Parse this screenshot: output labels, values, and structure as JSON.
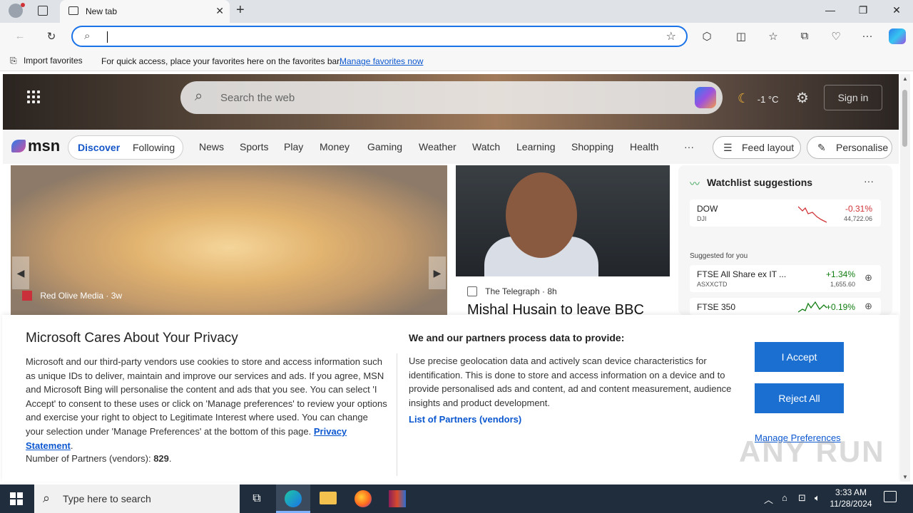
{
  "browser": {
    "tab_title": "New tab",
    "address_value": "",
    "favorites_bar": {
      "import_label": "Import favorites",
      "hint_text": "For quick access, place your favorites here on the favorites bar.",
      "manage_link": "Manage favorites now"
    }
  },
  "msn": {
    "search_placeholder": "Search the web",
    "weather_temp": "-1 °C",
    "sign_in": "Sign in",
    "logo_text": "msn",
    "tabs": {
      "discover": "Discover",
      "following": "Following"
    },
    "nav": [
      "News",
      "Sports",
      "Play",
      "Money",
      "Gaming",
      "Weather",
      "Watch",
      "Learning",
      "Shopping",
      "Health"
    ],
    "more": "···",
    "feed_layout": "Feed layout",
    "personalise": "Personalise",
    "card1": {
      "source": "Red Olive Media",
      "age": "3w"
    },
    "card2": {
      "source": "The Telegraph",
      "age": "8h",
      "headline": "Mishal Husain to leave BBC"
    },
    "watchlist": {
      "title": "Watchlist suggestions",
      "more": "···",
      "suggested_label": "Suggested for you",
      "stocks": [
        {
          "symbol": "DOW",
          "sub": "DJI",
          "change": "-0.31%",
          "price": "44,722.06",
          "color": "#d13438"
        },
        {
          "symbol": "FTSE All Share ex IT ...",
          "sub": "ASXXCTD",
          "change": "+1.34%",
          "price": "1,655.60",
          "color": "#107c10"
        },
        {
          "symbol": "FTSE 350",
          "sub": "",
          "change": "+0.19%",
          "price": "",
          "color": "#107c10"
        }
      ]
    }
  },
  "privacy": {
    "title": "Microsoft Cares About Your Privacy",
    "body": "Microsoft and our third-party vendors use cookies to store and access information such as unique IDs to deliver, maintain and improve our services and ads. If you agree, MSN and Microsoft Bing will personalise the content and ads that you see. You can select 'I Accept' to consent to these uses or click on 'Manage preferences' to review your options and exercise your right to object to Legitimate Interest where used.  You can change your selection under 'Manage Preferences' at the bottom of this page.",
    "privacy_link": "Privacy Statement",
    "partners_label": "Number of Partners (vendors):",
    "partners_count": "829",
    "process_title": "We and our partners process data to provide:",
    "process_body": "Use precise geolocation data and actively scan device characteristics for identification. This is done to store and access information on a device and to provide personalised ads and content, ad and content measurement, audience insights and product development.",
    "vendors_link": "List of Partners (vendors)",
    "accept": "I Accept",
    "reject": "Reject All",
    "manage": "Manage Preferences"
  },
  "watermark": "ANY RUN",
  "taskbar": {
    "search_placeholder": "Type here to search",
    "time": "3:33 AM",
    "date": "11/28/2024"
  },
  "icons": [
    "profile-icon",
    "tab-actions-icon",
    "new-tab-icon",
    "back-icon",
    "refresh-icon",
    "search-icon",
    "favorite-star-icon",
    "extensions-icon",
    "split-screen-icon",
    "favorites-icon",
    "collections-icon",
    "performance-icon",
    "more-icon",
    "copilot-icon",
    "apps-grid-icon",
    "moon-icon",
    "gear-icon",
    "windows-start-icon",
    "task-view-icon",
    "edge-icon",
    "file-explorer-icon",
    "firefox-icon",
    "winrar-icon",
    "chevron-up-icon",
    "network-icon",
    "volume-icon",
    "notifications-icon"
  ]
}
